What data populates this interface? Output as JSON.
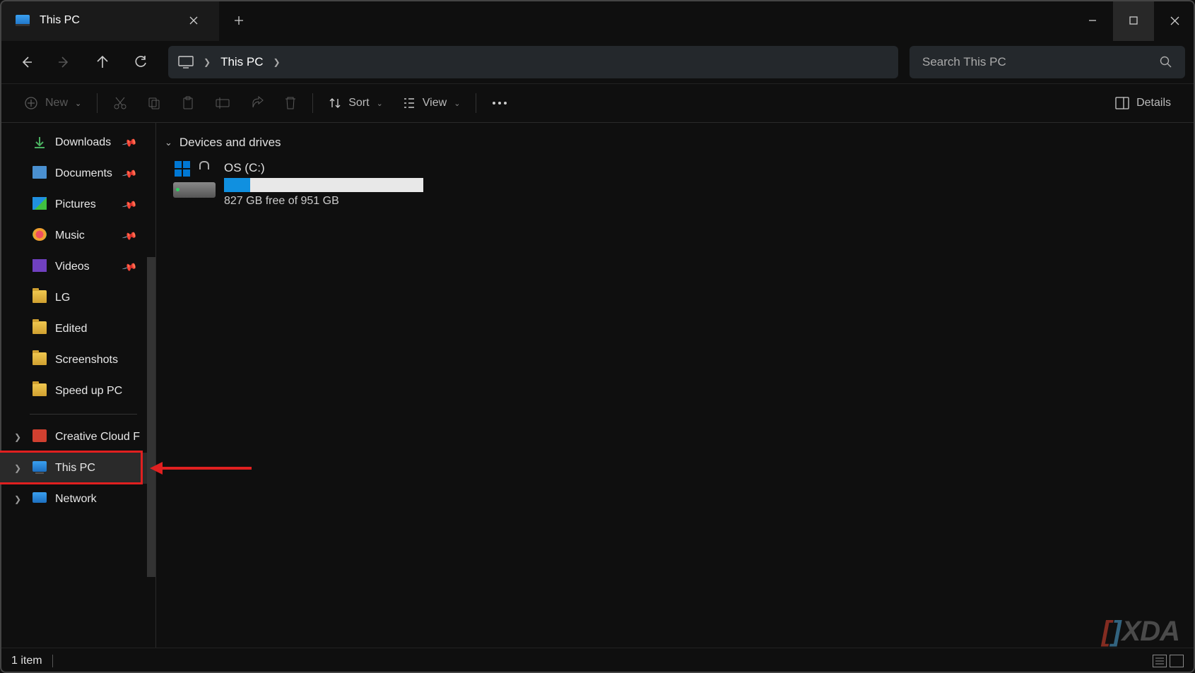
{
  "window": {
    "tab_title": "This PC",
    "addressbar": {
      "location": "This PC"
    },
    "search_placeholder": "Search This PC"
  },
  "toolbar": {
    "new_label": "New",
    "sort_label": "Sort",
    "view_label": "View",
    "details_label": "Details"
  },
  "sidebar": {
    "quick": [
      {
        "label": "Downloads",
        "pinned": true,
        "icon": "download"
      },
      {
        "label": "Documents",
        "pinned": true,
        "icon": "document"
      },
      {
        "label": "Pictures",
        "pinned": true,
        "icon": "pictures"
      },
      {
        "label": "Music",
        "pinned": true,
        "icon": "music"
      },
      {
        "label": "Videos",
        "pinned": true,
        "icon": "videos"
      },
      {
        "label": "LG",
        "pinned": false,
        "icon": "folder"
      },
      {
        "label": "Edited",
        "pinned": false,
        "icon": "folder"
      },
      {
        "label": "Screenshots",
        "pinned": false,
        "icon": "folder"
      },
      {
        "label": "Speed up PC",
        "pinned": false,
        "icon": "folder"
      }
    ],
    "roots": [
      {
        "label": "Creative Cloud F",
        "icon": "cc"
      },
      {
        "label": "This PC",
        "icon": "pc",
        "highlighted": true
      },
      {
        "label": "Network",
        "icon": "net"
      }
    ]
  },
  "main": {
    "section_title": "Devices and drives",
    "drives": [
      {
        "name": "OS (C:)",
        "free_text": "827 GB free of 951 GB",
        "fill_percent": 13
      }
    ]
  },
  "statusbar": {
    "item_count": "1 item"
  },
  "watermark": "XDA"
}
